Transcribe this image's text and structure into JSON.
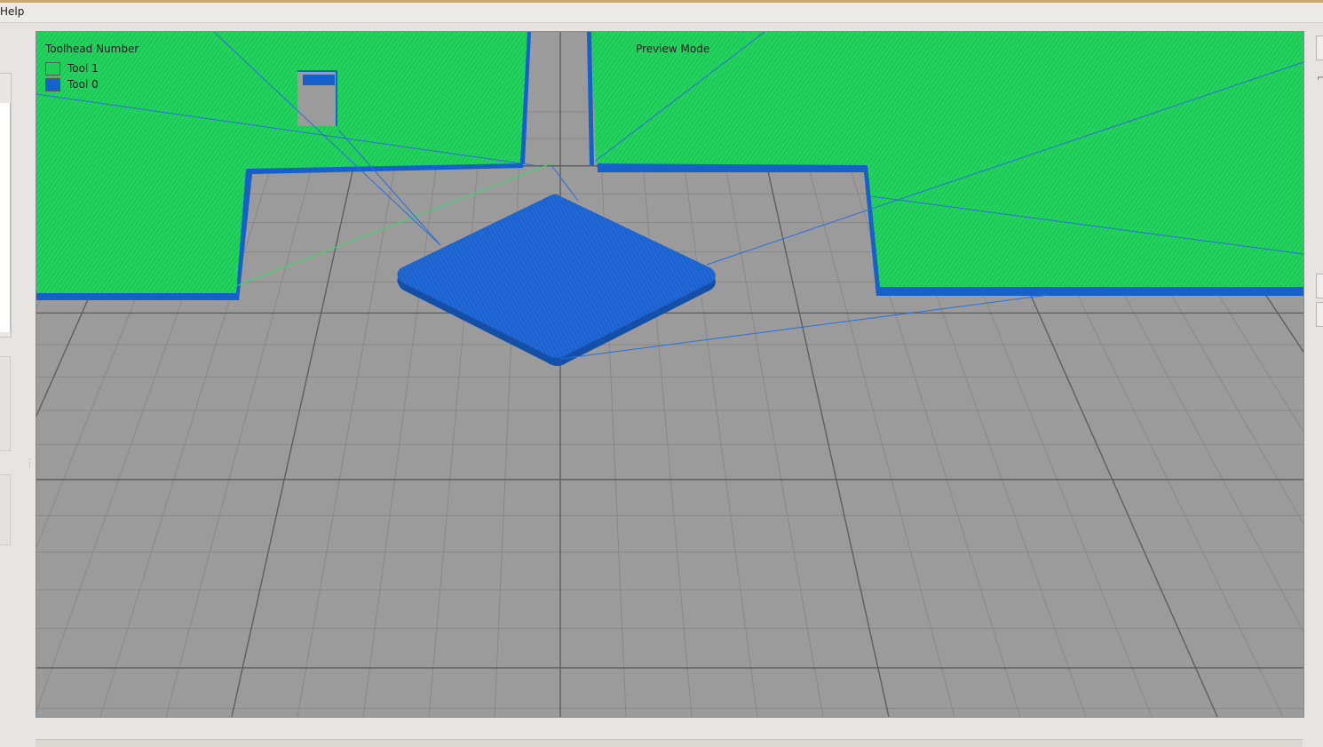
{
  "menubar": {
    "help_label": "Help"
  },
  "viewport": {
    "mode_label": "Preview Mode",
    "legend": {
      "title": "Toolhead Number",
      "items": [
        {
          "label": "Tool 1",
          "color": "#1fcf5a"
        },
        {
          "label": "Tool 0",
          "color": "#1660c9"
        }
      ]
    },
    "colors": {
      "bed": "#9b9b9b",
      "grid_minor": "#858585",
      "grid_major": "#5f5f5f",
      "tool1_fill": "#1fcf5a",
      "tool1_edge": "#1660c9",
      "tool0": "#1f68d6"
    }
  },
  "right_toolbar": {
    "icons": [
      "tool-icon",
      "layer-icon",
      "view-icon"
    ]
  }
}
